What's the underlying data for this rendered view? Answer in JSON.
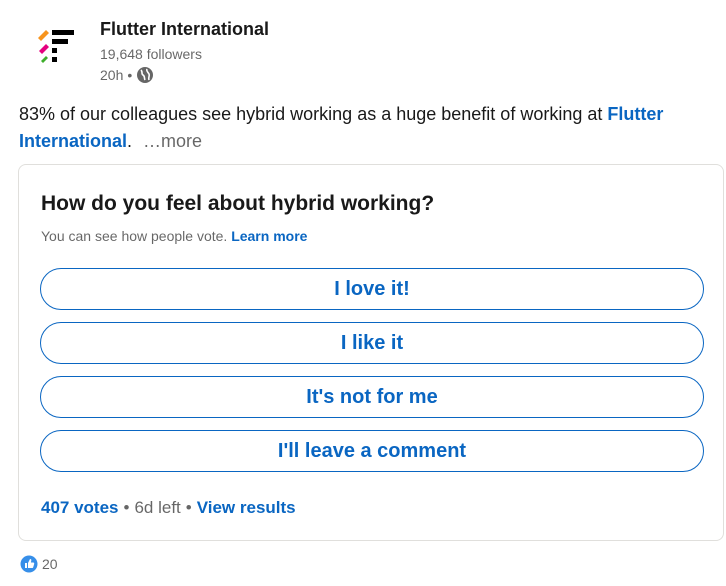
{
  "company": {
    "name": "Flutter International",
    "followers": "19,648 followers",
    "time": "20h",
    "time_separator": "•",
    "logo_icon": "flutter-logo-icon",
    "visibility_icon": "globe-icon"
  },
  "post": {
    "text_before": "83% of our colleagues see hybrid working as a huge benefit of working at",
    "mention": "Flutter International",
    "text_after": ".",
    "more_label": "…more"
  },
  "poll": {
    "question": "How do you feel about hybrid working?",
    "subtitle": "You can see how people vote.",
    "learn_more": "Learn more",
    "options": [
      {
        "label": "I love it!"
      },
      {
        "label": "I like it"
      },
      {
        "label": "It's not for me"
      },
      {
        "label": "I'll leave a comment"
      }
    ],
    "votes": "407 votes",
    "separator": "•",
    "time_left": "6d left",
    "view_results": "View results"
  },
  "reactions": {
    "count": "20",
    "icon": "like-icon"
  },
  "colors": {
    "accent": "#0a66c2",
    "logo_orange": "#f7941d",
    "logo_pink": "#e5007e",
    "logo_green": "#3dae2b",
    "logo_black": "#000000"
  }
}
